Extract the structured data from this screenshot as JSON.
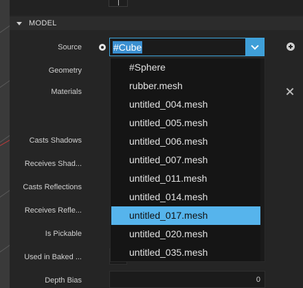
{
  "section": {
    "title": "MODEL"
  },
  "labels": {
    "source": "Source",
    "geometry": "Geometry",
    "materials": "Materials",
    "casts_shadows": "Casts Shadows",
    "receives_shadows": "Receives Shad...",
    "casts_reflections": "Casts Reflections",
    "receives_reflections": "Receives Refle...",
    "is_pickable": "Is Pickable",
    "used_in_baked": "Used in Baked ...",
    "depth_bias": "Depth Bias"
  },
  "source_select": {
    "value": "#Cube"
  },
  "depth_bias": {
    "value": "0"
  },
  "dropdown": {
    "options": [
      "#Sphere",
      "rubber.mesh",
      "untitled_004.mesh",
      "untitled_005.mesh",
      "untitled_006.mesh",
      "untitled_007.mesh",
      "untitled_011.mesh",
      "untitled_014.mesh",
      "untitled_017.mesh",
      "untitled_020.mesh",
      "untitled_035.mesh"
    ],
    "selected": "untitled_017.mesh"
  },
  "icons": {
    "source_pin": "circle-dot-icon",
    "add": "plus-circle-icon",
    "remove": "close-icon",
    "expand": "chevron-down-icon",
    "section_toggle": "caret-down-icon"
  },
  "colors": {
    "accent": "#3f9fd8",
    "selection": "#56b4ec",
    "panel": "#252525"
  }
}
